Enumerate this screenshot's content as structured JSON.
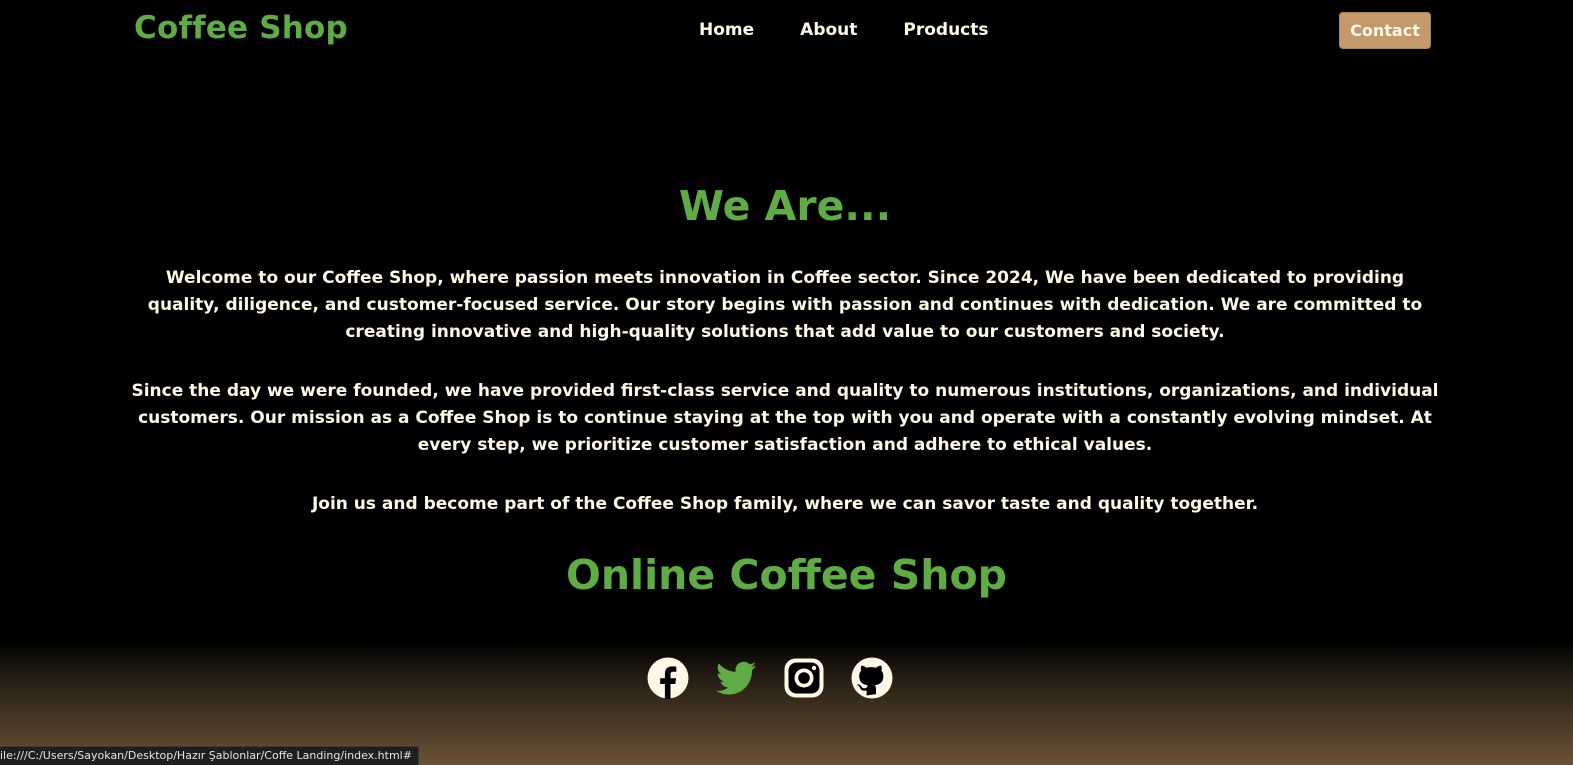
{
  "header": {
    "logo": "Coffee Shop",
    "nav": [
      "Home",
      "About",
      "Products"
    ],
    "contact_label": "Contact"
  },
  "about": {
    "title": "We Are...",
    "paragraphs": [
      "Welcome to our Coffee Shop, where passion meets innovation in Coffee sector. Since 2024, We have been dedicated to providing quality, diligence, and customer-focused service. Our story begins with passion and continues with dedication. We are committed to creating innovative and high-quality solutions that add value to our customers and society.",
      "Since the day we were founded, we have provided first-class service and quality to numerous institutions, organizations, and individual customers. Our mission as a Coffee Shop is to continue staying at the top with you and operate with a constantly evolving mindset. At every step, we prioritize customer satisfaction and adhere to ethical values.",
      "Join us and become part of the Coffee Shop family, where we can savor taste and quality together."
    ]
  },
  "shop": {
    "title": "Online Coffee Shop"
  },
  "socials": [
    {
      "icon": "facebook-icon",
      "color": "#fff8e6"
    },
    {
      "icon": "twitter-icon",
      "color": "#5fac44"
    },
    {
      "icon": "instagram-icon",
      "color": "#fff8e6"
    },
    {
      "icon": "github-icon",
      "color": "#fff8e6"
    }
  ],
  "status_bar": {
    "text": "ile:///C:/Users/Sayokan/Desktop/Hazır Şablonlar/Coffe Landing/index.html#"
  },
  "colors": {
    "accent_green": "#5fac44",
    "contact_button": "#c49a6c",
    "text_cream": "#fff8e6",
    "background": "#000000"
  }
}
